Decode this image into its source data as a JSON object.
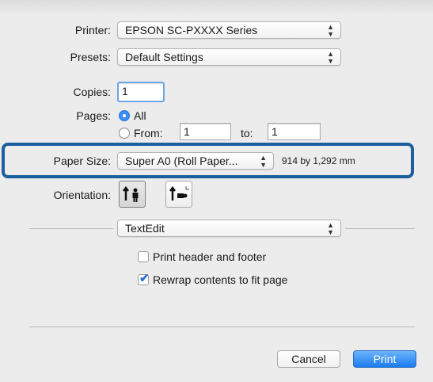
{
  "printer": {
    "label": "Printer:",
    "value": "EPSON SC-PXXXX Series"
  },
  "presets": {
    "label": "Presets:",
    "value": "Default Settings"
  },
  "copies": {
    "label": "Copies:",
    "value": "1"
  },
  "pages": {
    "label": "Pages:",
    "all_label": "All",
    "from_label": "From:",
    "from_value": "1",
    "to_label": "to:",
    "to_value": "1",
    "selected": "All"
  },
  "paper_size": {
    "label": "Paper Size:",
    "value": "Super A0 (Roll Paper...",
    "dimensions": "914 by 1,292 mm"
  },
  "orientation": {
    "label": "Orientation:",
    "options": [
      "portrait-icon",
      "landscape-icon"
    ],
    "selected": "portrait-icon"
  },
  "section_popup": {
    "value": "TextEdit"
  },
  "options": [
    {
      "label": "Print header and footer",
      "checked": false
    },
    {
      "label": "Rewrap contents to fit page",
      "checked": true
    }
  ],
  "buttons": {
    "cancel": "Cancel",
    "print": "Print"
  },
  "colors": {
    "highlight": "#1c5fa0",
    "accent": "#3b8df7"
  }
}
